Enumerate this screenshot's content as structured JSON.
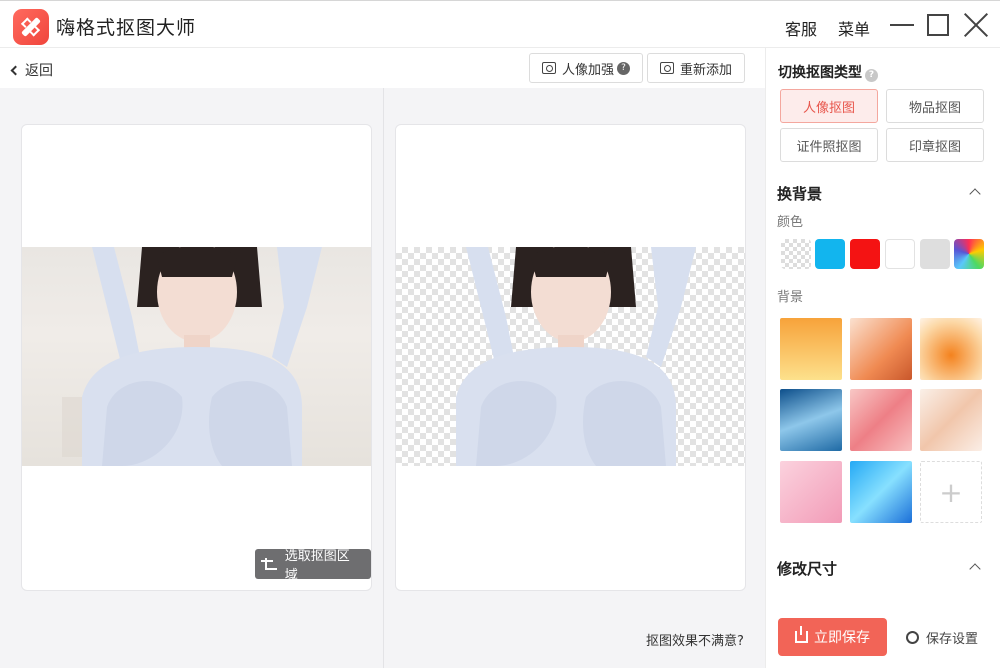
{
  "app": {
    "title": "嗨格式抠图大师",
    "support_label": "客服",
    "menu_label": "菜单"
  },
  "toolbar": {
    "back_label": "返回",
    "portrait_enhance_label": "人像加强",
    "readd_label": "重新添加"
  },
  "work": {
    "select_area_label": "选取抠图区域",
    "unsatisfied_label": "抠图效果不满意?"
  },
  "sidebar": {
    "switch_type_title": "切换抠图类型",
    "cutout_types": [
      {
        "label": "人像抠图",
        "active": true
      },
      {
        "label": "物品抠图",
        "active": false
      },
      {
        "label": "证件照抠图",
        "active": false
      },
      {
        "label": "印章抠图",
        "active": false
      }
    ],
    "change_bg_title": "换背景",
    "color_label": "颜色",
    "colors": [
      "transparent",
      "#12b5ee",
      "#f41313",
      "#ffffff",
      "#dedede",
      "rainbow"
    ],
    "background_label": "背景",
    "resize_title": "修改尺寸",
    "save_label": "立即保存",
    "save_settings_label": "保存设置"
  }
}
